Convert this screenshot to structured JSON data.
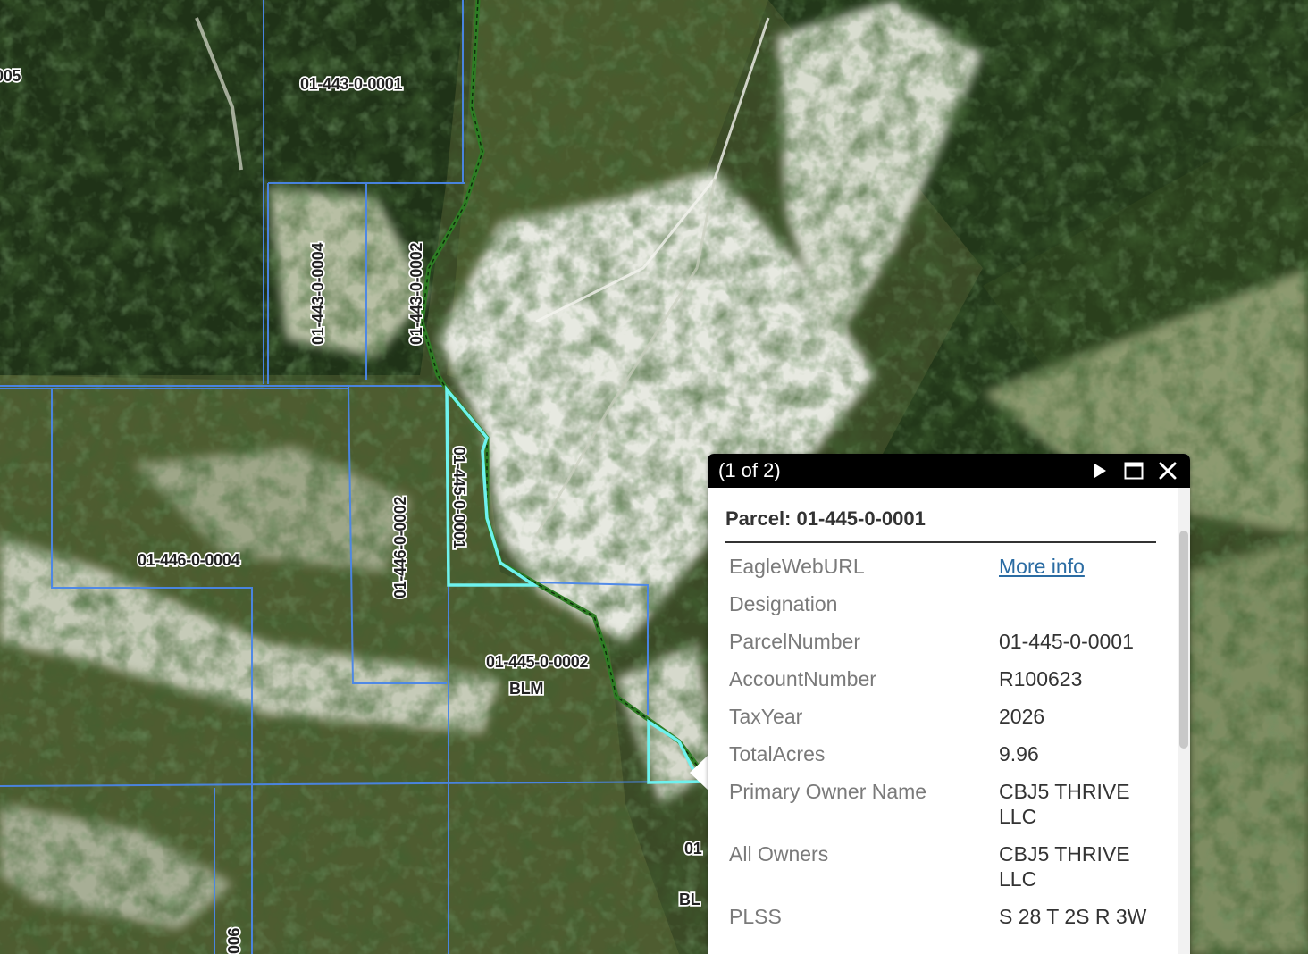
{
  "map": {
    "parcel_labels": [
      {
        "id": "lbl-005-partial",
        "text": "005"
      },
      {
        "id": "lbl-443-0001",
        "text": "01-443-0-0001"
      },
      {
        "id": "lbl-443-0004",
        "text": "01-443-0-0004"
      },
      {
        "id": "lbl-443-0002",
        "text": "01-443-0-0002"
      },
      {
        "id": "lbl-445-0001",
        "text": "01-445-0-0001"
      },
      {
        "id": "lbl-446-0002",
        "text": "01-446-0-0002"
      },
      {
        "id": "lbl-446-0004",
        "text": "01-446-0-0004"
      },
      {
        "id": "lbl-445-0002",
        "text": "01-445-0-0002"
      },
      {
        "id": "lbl-blm",
        "text": "BLM"
      },
      {
        "id": "lbl-01-partial",
        "text": "01"
      },
      {
        "id": "lbl-bl-partial",
        "text": "BL"
      },
      {
        "id": "lbl-006-partial",
        "text": "006"
      }
    ],
    "colors": {
      "parcel_line": "#4a86e8",
      "selected_parcel": "#6ef2ee",
      "road_line": "#2e7d24"
    }
  },
  "popup": {
    "count": "(1 of 2)",
    "title": "Parcel: 01-445-0-0001",
    "buttons": {
      "next_icon": "play-icon",
      "maximize_icon": "maximize-icon",
      "close_icon": "close-icon"
    },
    "attributes": [
      {
        "name": "EagleWebURL",
        "value": "More info",
        "is_link": true
      },
      {
        "name": "Designation",
        "value": ""
      },
      {
        "name": "ParcelNumber",
        "value": "01-445-0-0001"
      },
      {
        "name": "AccountNumber",
        "value": "R100623"
      },
      {
        "name": "TaxYear",
        "value": "2026"
      },
      {
        "name": "TotalAcres",
        "value": "9.96"
      },
      {
        "name": "Primary Owner Name",
        "value": "CBJ5 THRIVE LLC"
      },
      {
        "name": "All Owners",
        "value": "CBJ5 THRIVE LLC"
      },
      {
        "name": "PLSS",
        "value": "S 28 T 2S R 3W"
      }
    ]
  }
}
